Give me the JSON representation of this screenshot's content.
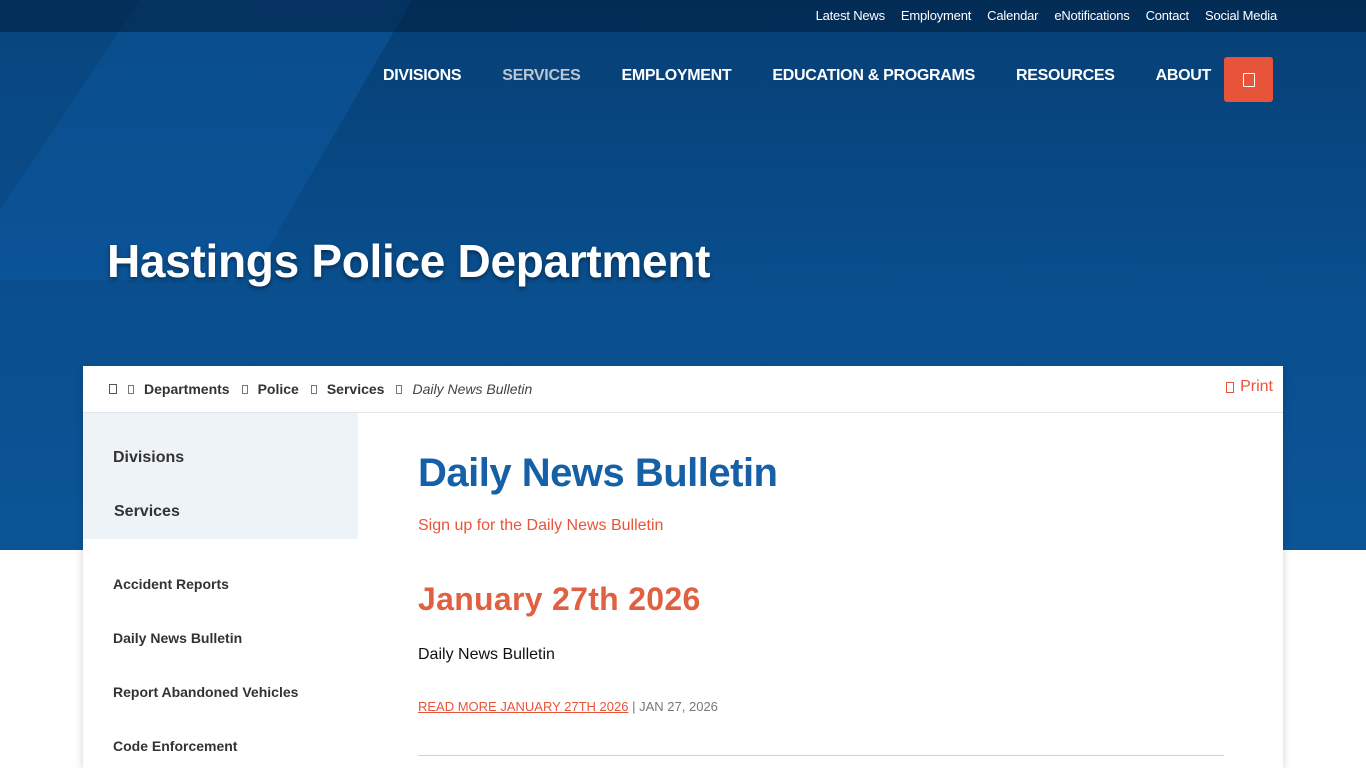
{
  "colors": {
    "brand_blue": "#0a4f8f",
    "title_blue": "#1560a6",
    "accent_orange": "#e8543a"
  },
  "utility_nav": [
    "Latest News",
    "Employment",
    "Calendar",
    "eNotifications",
    "Contact",
    "Social Media"
  ],
  "main_nav": [
    {
      "label": "DIVISIONS",
      "active": false
    },
    {
      "label": "SERVICES",
      "active": true
    },
    {
      "label": "EMPLOYMENT",
      "active": false
    },
    {
      "label": "EDUCATION & PROGRAMS",
      "active": false
    },
    {
      "label": "RESOURCES",
      "active": false
    },
    {
      "label": "ABOUT",
      "active": false
    }
  ],
  "search_icon": "search-icon",
  "hero": {
    "title": "Hastings Police Department"
  },
  "breadcrumb": {
    "home_icon": "home-icon",
    "items": [
      "Departments",
      "Police",
      "Services"
    ],
    "current": "Daily News Bulletin"
  },
  "print": {
    "label": "Print",
    "icon": "print-icon"
  },
  "sidebar": {
    "top_items": [
      "Divisions",
      "Services"
    ],
    "links": [
      "Accident Reports",
      "Daily News Bulletin",
      "Report Abandoned Vehicles",
      "Code Enforcement"
    ]
  },
  "main": {
    "title": "Daily News Bulletin",
    "signup_link": "Sign up for the Daily News Bulletin",
    "post": {
      "date_heading": "January 27th 2026",
      "body": "Daily News Bulletin",
      "read_more": "READ MORE JANUARY 27TH 2026",
      "separator": "|",
      "date": "JAN 27, 2026"
    }
  }
}
